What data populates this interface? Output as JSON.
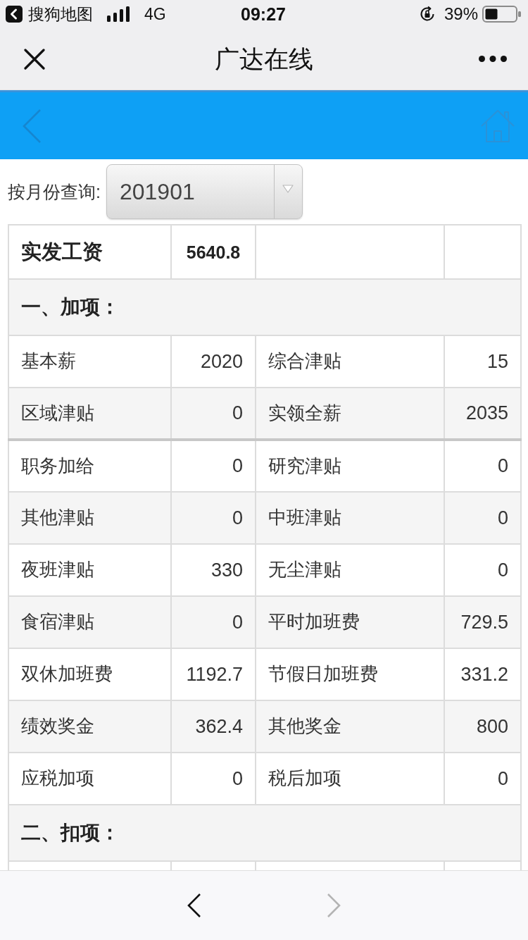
{
  "status_bar": {
    "back_app": "搜狗地图",
    "network": "4G",
    "time": "09:27",
    "battery": "39%"
  },
  "nav_bar": {
    "title": "广达在线"
  },
  "query": {
    "label": "按月份查询:",
    "value": "201901"
  },
  "table": {
    "summary": {
      "label": "实发工资",
      "value": "5640.8"
    },
    "sections": [
      {
        "title": "一、加项：",
        "groups": [
          {
            "rows": [
              {
                "items": [
                  {
                    "label": "基本薪",
                    "value": "2020"
                  },
                  {
                    "label": "综合津贴",
                    "value": "15"
                  }
                ]
              },
              {
                "items": [
                  {
                    "label": "区域津贴",
                    "value": "0"
                  },
                  {
                    "label": "实领全薪",
                    "value": "2035"
                  }
                ]
              }
            ]
          },
          {
            "rows": [
              {
                "items": [
                  {
                    "label": "职务加给",
                    "value": "0"
                  },
                  {
                    "label": "研究津贴",
                    "value": "0"
                  }
                ]
              },
              {
                "items": [
                  {
                    "label": "其他津贴",
                    "value": "0"
                  },
                  {
                    "label": "中班津贴",
                    "value": "0"
                  }
                ]
              },
              {
                "items": [
                  {
                    "label": "夜班津贴",
                    "value": "330"
                  },
                  {
                    "label": "无尘津贴",
                    "value": "0"
                  }
                ]
              },
              {
                "items": [
                  {
                    "label": "食宿津贴",
                    "value": "0"
                  },
                  {
                    "label": "平时加班费",
                    "value": "729.5"
                  }
                ]
              },
              {
                "items": [
                  {
                    "label": "双休加班费",
                    "value": "1192.7"
                  },
                  {
                    "label": "节假日加班费",
                    "value": "331.2"
                  }
                ]
              },
              {
                "items": [
                  {
                    "label": "绩效奖金",
                    "value": "362.4"
                  },
                  {
                    "label": "其他奖金",
                    "value": "800"
                  }
                ]
              },
              {
                "items": [
                  {
                    "label": "应税加项",
                    "value": "0"
                  },
                  {
                    "label": "税后加项",
                    "value": "0"
                  }
                ]
              }
            ]
          }
        ]
      },
      {
        "title": "二、扣项："
      }
    ]
  },
  "toolbar": {
    "back": {
      "disabled": false
    },
    "forward": {
      "disabled": true
    }
  }
}
